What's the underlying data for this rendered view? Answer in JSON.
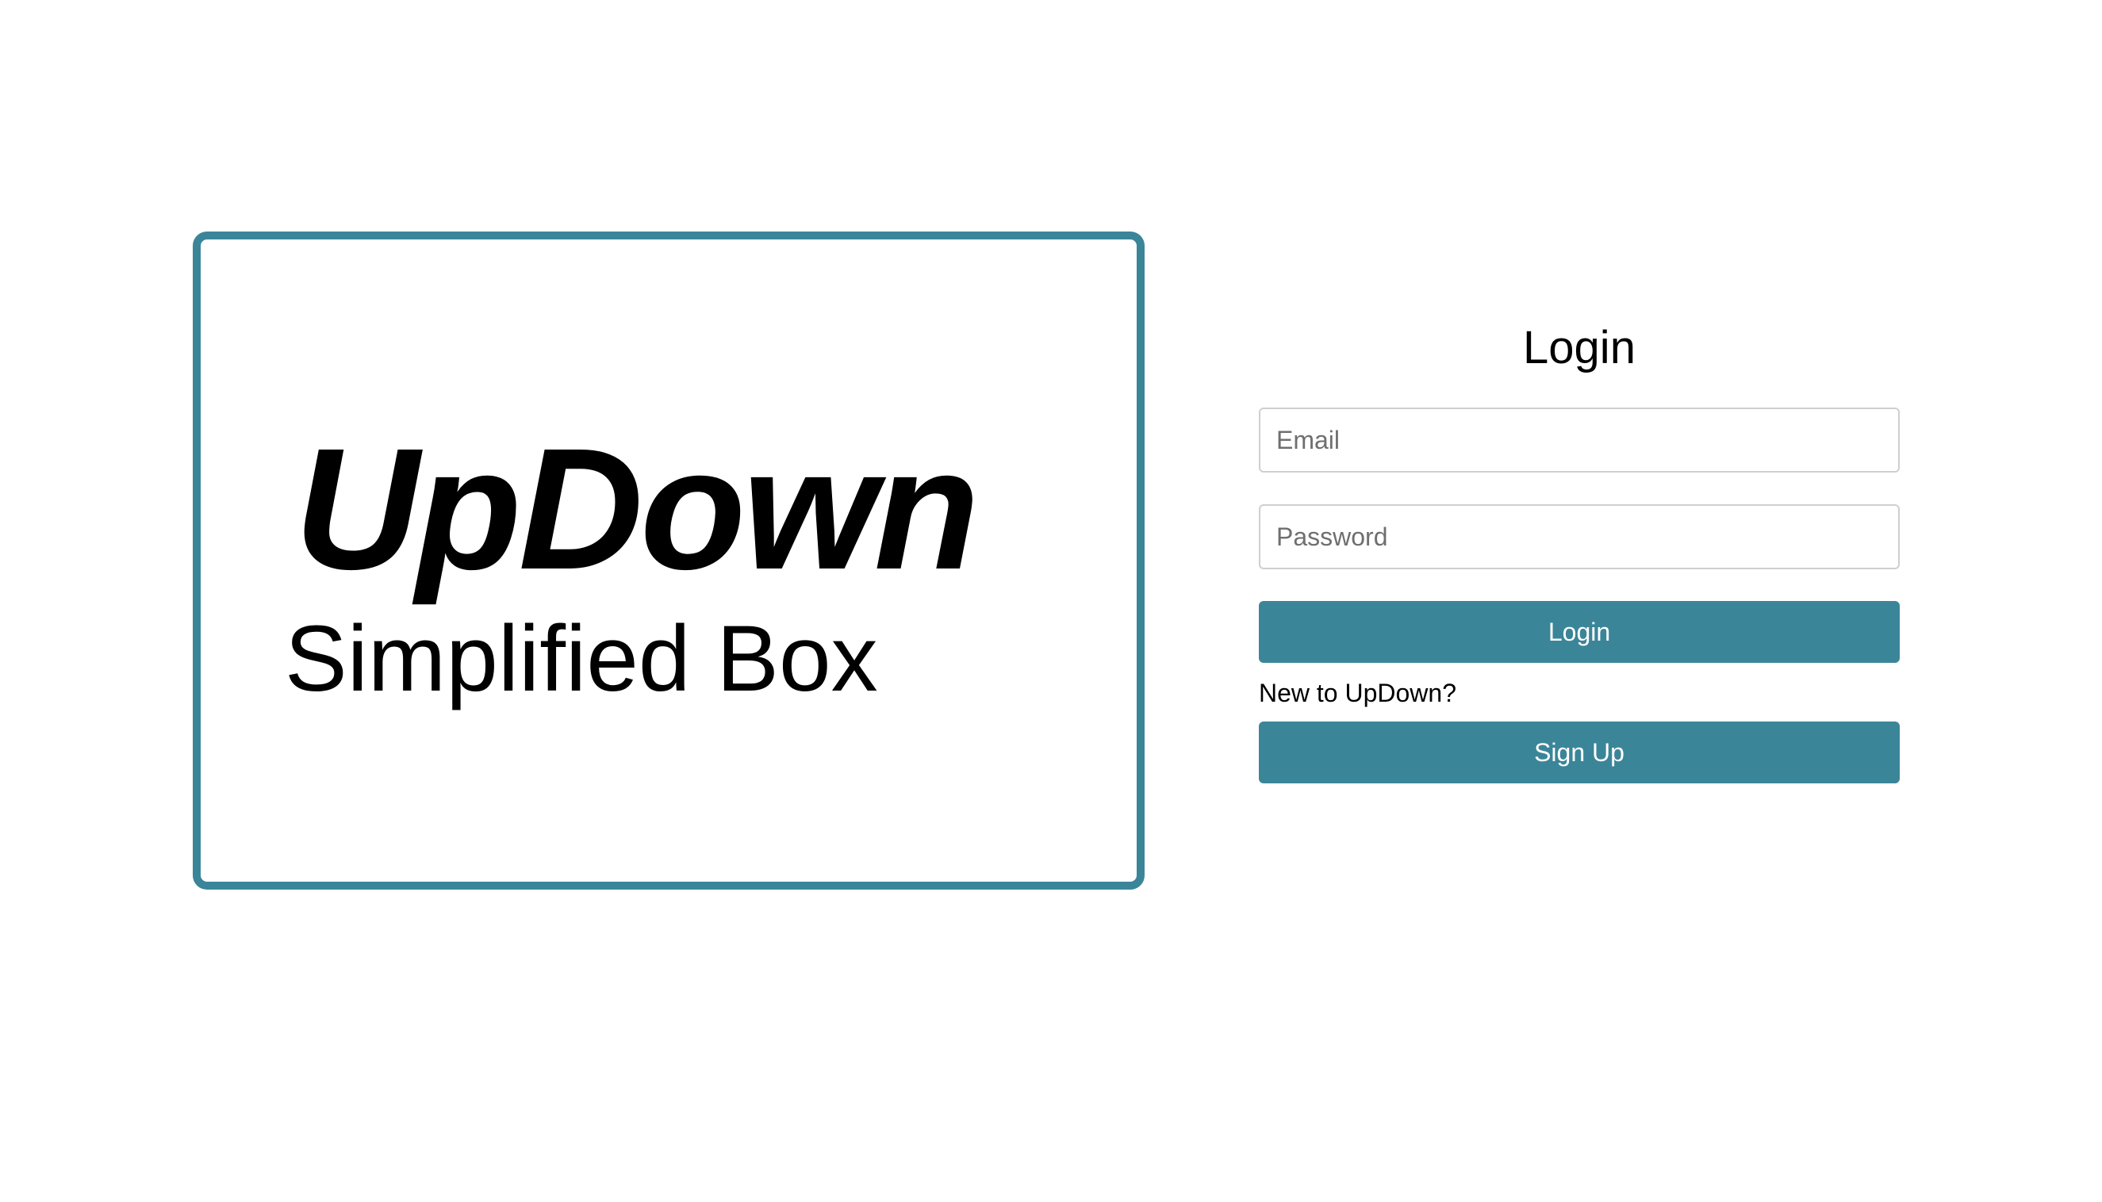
{
  "brand": {
    "name": "UpDown",
    "tagline": "Simplified Box"
  },
  "login": {
    "title": "Login",
    "email_placeholder": "Email",
    "password_placeholder": "Password",
    "login_button": "Login",
    "new_user_prompt": "New to UpDown?",
    "signup_button": "Sign Up"
  },
  "colors": {
    "accent": "#3b8599",
    "input_border": "#cfcfcf"
  }
}
